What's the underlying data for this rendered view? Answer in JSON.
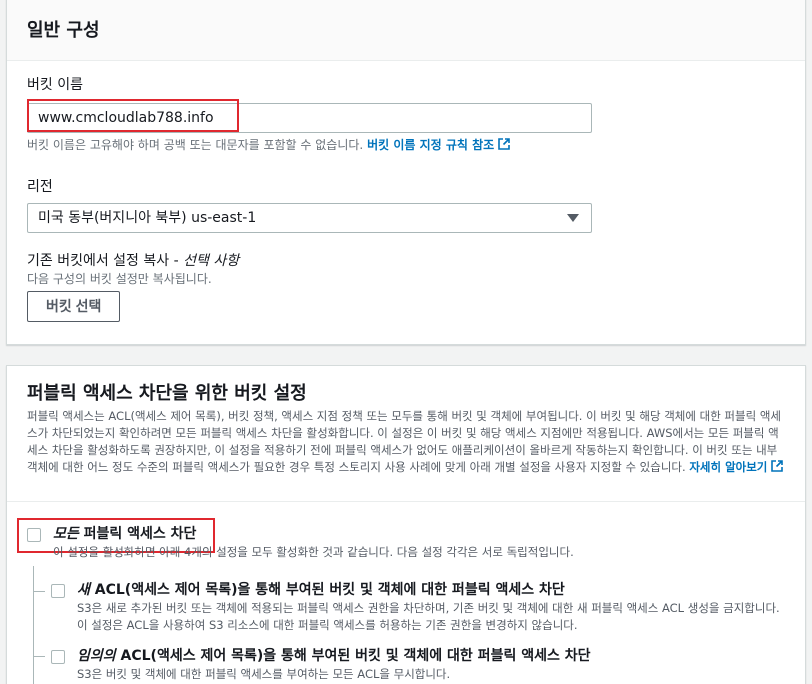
{
  "general": {
    "title": "일반 구성",
    "bucket_name": {
      "label": "버킷 이름",
      "value": "www.cmcloudlab788.info",
      "help": "버킷 이름은 고유해야 하며 공백 또는 대문자를 포함할 수 없습니다.",
      "help_link": "버킷 이름 지정 규칙 참조"
    },
    "region": {
      "label": "리전",
      "value": "미국 동부(버지니아 북부) us-east-1"
    },
    "copy_settings": {
      "label": "기존 버킷에서 설정 복사 - ",
      "label_optional": "선택 사항",
      "help": "다음 구성의 버킷 설정만 복사됩니다.",
      "button": "버킷 선택"
    }
  },
  "public_access": {
    "title": "퍼블릭 액세스 차단을 위한 버킷 설정",
    "description": "퍼블릭 액세스는 ACL(액세스 제어 목록), 버킷 정책, 액세스 지점 정책 또는 모두를 통해 버킷 및 객체에 부여됩니다. 이 버킷 및 해당 객체에 대한 퍼블릭 액세스가 차단되었는지 확인하려면 모든 퍼블릭 액세스 차단을 활성화합니다. 이 설정은 이 버킷 및 해당 액세스 지점에만 적용됩니다. AWS에서는 모든 퍼블릭 액세스 차단을 활성화하도록 권장하지만, 이 설정을 적용하기 전에 퍼블릭 액세스가 없어도 애플리케이션이 올바르게 작동하는지 확인합니다. 이 버킷 또는 내부 객체에 대한 어느 정도 수준의 퍼블릭 액세스가 필요한 경우 특정 스토리지 사용 사례에 맞게 아래 개별 설정을 사용자 지정할 수 있습니다. ",
    "learn_more": "자세히 알아보기",
    "block_all": {
      "title_em": "모든",
      "title": " 퍼블릭 액세스 차단",
      "desc": "이 설정을 활성화하면 아래 4개의 설정을 모두 활성화한 것과 같습니다. 다음 설정 각각은 서로 독립적입니다."
    },
    "options": [
      {
        "title_em": "새",
        "title": " ACL(액세스 제어 목록)을 통해 부여된 버킷 및 객체에 대한 퍼블릭 액세스 차단",
        "desc": "S3은 새로 추가된 버킷 또는 객체에 적용되는 퍼블릭 액세스 권한을 차단하며, 기존 버킷 및 객체에 대한 새 퍼블릭 액세스 ACL 생성을 금지합니다. 이 설정은 ACL을 사용하여 S3 리소스에 대한 퍼블릭 액세스를 허용하는 기존 권한을 변경하지 않습니다."
      },
      {
        "title_em": "임의의",
        "title": " ACL(액세스 제어 목록)을 통해 부여된 버킷 및 객체에 대한 퍼블릭 액세스 차단",
        "desc": "S3은 버킷 및 객체에 대한 퍼블릭 액세스를 부여하는 모든 ACL을 무시합니다."
      }
    ]
  },
  "colors": {
    "link": "#0073bb",
    "highlight": "#e0282f",
    "background": "#f2f3f3"
  }
}
